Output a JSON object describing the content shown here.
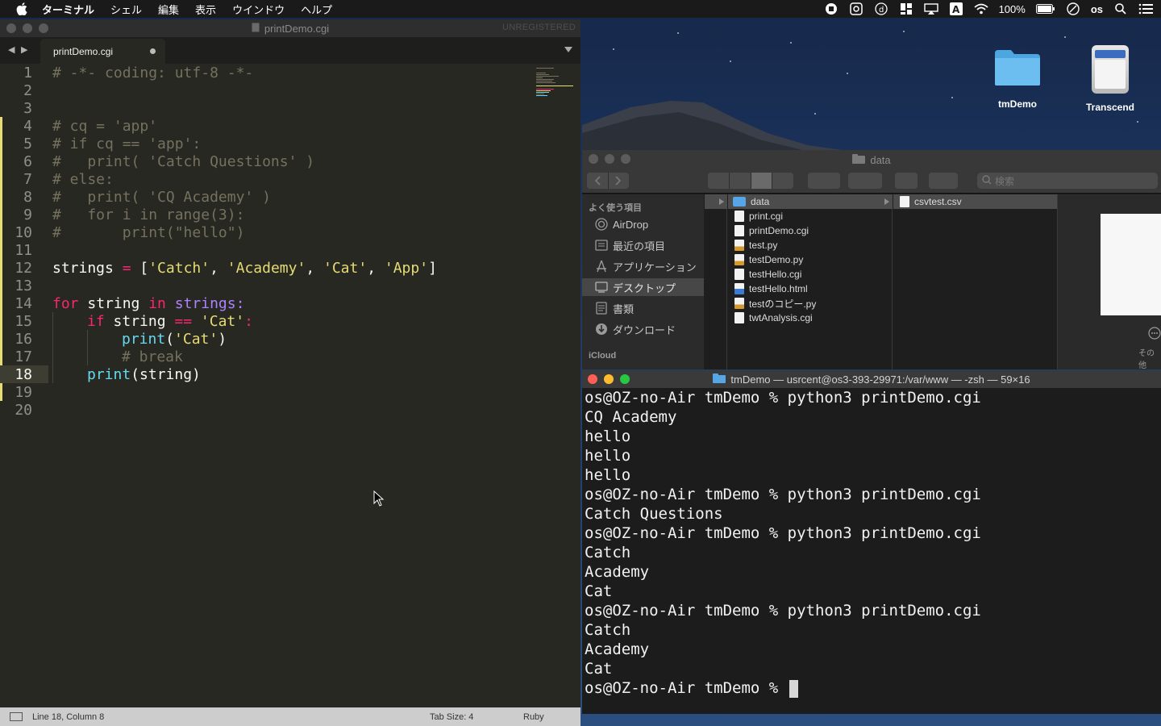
{
  "menubar": {
    "app_name": "ターミナル",
    "menus": [
      "シェル",
      "編集",
      "表示",
      "ウインドウ",
      "ヘルプ"
    ],
    "battery": "100%",
    "user": "os",
    "icons": [
      "apple-icon",
      "record-icon",
      "camera-icon",
      "dictionary-icon",
      "grid-icon",
      "airplay-icon",
      "input-a-icon",
      "wifi-icon",
      "battery-icon",
      "clock-icon",
      "search-icon",
      "list-icon"
    ]
  },
  "editor": {
    "window_title": "printDemo.cgi",
    "unregistered": "UNREGISTERED",
    "tab_label": "printDemo.cgi",
    "nav_arrows": "◀ ▶",
    "lines": [
      {
        "n": "1"
      },
      {
        "n": "2"
      },
      {
        "n": "3"
      },
      {
        "n": "4"
      },
      {
        "n": "5"
      },
      {
        "n": "6"
      },
      {
        "n": "7"
      },
      {
        "n": "8"
      },
      {
        "n": "9"
      },
      {
        "n": "10"
      },
      {
        "n": "11"
      },
      {
        "n": "12"
      },
      {
        "n": "13"
      },
      {
        "n": "14"
      },
      {
        "n": "15"
      },
      {
        "n": "16"
      },
      {
        "n": "17"
      },
      {
        "n": "18"
      },
      {
        "n": "19"
      },
      {
        "n": "20"
      }
    ],
    "code": {
      "l1": "# -*- coding: utf-8 -*-",
      "l4": "# cq = 'app'",
      "l5": "# if cq == 'app':",
      "l6": "#   print( 'Catch Questions' )",
      "l7": "# else:",
      "l8": "#   print( 'CQ Academy' )",
      "l9": "#   for i in range(3):",
      "l10": "#       print(\"hello\")",
      "l12": {
        "a": "strings",
        "b": " = ",
        "c": "[",
        "d": "'Catch'",
        "e": ", ",
        "f": "'Academy'",
        "g": ", ",
        "h": "'Cat'",
        "i": ", ",
        "j": "'App'",
        "k": "]"
      },
      "l14": {
        "a": "for",
        "b": " string ",
        "c": "in",
        "d": " strings:"
      },
      "l15": {
        "a": "if",
        "b": " string ",
        "c": "==",
        "d": " 'Cat'",
        "e": ":"
      },
      "l16": {
        "a": "print",
        "b": "(",
        "c": "'Cat'",
        "d": ")"
      },
      "l17": "# break",
      "l18": {
        "a": "print",
        "b": "(string)"
      }
    },
    "status": {
      "position": "Line 18, Column 8",
      "tab_size": "Tab Size: 4",
      "syntax": "Ruby"
    }
  },
  "desktop": {
    "icons": [
      {
        "label": "tmDemo",
        "icon": "folder-icon"
      },
      {
        "label": "Transcend",
        "icon": "drive-icon"
      }
    ]
  },
  "finder": {
    "title": "data",
    "search_placeholder": "検索",
    "sidebar": {
      "favorites_heading": "よく使う項目",
      "items": [
        {
          "label": "AirDrop",
          "icon": "airdrop-icon"
        },
        {
          "label": "最近の項目",
          "icon": "recents-icon"
        },
        {
          "label": "アプリケーション",
          "icon": "applications-icon"
        },
        {
          "label": "デスクトップ",
          "icon": "desktop-icon"
        },
        {
          "label": "書類",
          "icon": "documents-icon"
        },
        {
          "label": "ダウンロード",
          "icon": "downloads-icon"
        }
      ],
      "icloud_heading": "iCloud"
    },
    "column2": [
      {
        "name": "data",
        "kind": "folder"
      },
      {
        "name": "print.cgi",
        "kind": "file"
      },
      {
        "name": "printDemo.cgi",
        "kind": "file"
      },
      {
        "name": "test.py",
        "kind": "py"
      },
      {
        "name": "testDemo.py",
        "kind": "py"
      },
      {
        "name": "testHello.cgi",
        "kind": "file"
      },
      {
        "name": "testHello.html",
        "kind": "html"
      },
      {
        "name": "testのコピー.py",
        "kind": "py"
      },
      {
        "name": "twtAnalysis.cgi",
        "kind": "file"
      }
    ],
    "column3": [
      {
        "name": "csvtest.csv",
        "kind": "file"
      }
    ],
    "preview_more": "その他"
  },
  "terminal": {
    "title": "tmDemo — usrcent@os3-393-29971:/var/www — -zsh — 59×16",
    "lines": [
      "os@OZ-no-Air tmDemo % python3 printDemo.cgi",
      "CQ Academy",
      "hello",
      "hello",
      "hello",
      "os@OZ-no-Air tmDemo % python3 printDemo.cgi",
      "Catch Questions",
      "os@OZ-no-Air tmDemo % python3 printDemo.cgi",
      "Catch",
      "Academy",
      "Cat",
      "os@OZ-no-Air tmDemo % python3 printDemo.cgi",
      "Catch",
      "Academy",
      "Cat"
    ],
    "prompt": "os@OZ-no-Air tmDemo % "
  },
  "colors": {
    "editor_bg": "#272822",
    "comment": "#75715e",
    "keyword": "#f92672",
    "string": "#e6db74",
    "function": "#66d9ef",
    "variable": "#ae81ff",
    "close": "#ff5f57",
    "minimize": "#febc2e",
    "zoom": "#28c840"
  }
}
